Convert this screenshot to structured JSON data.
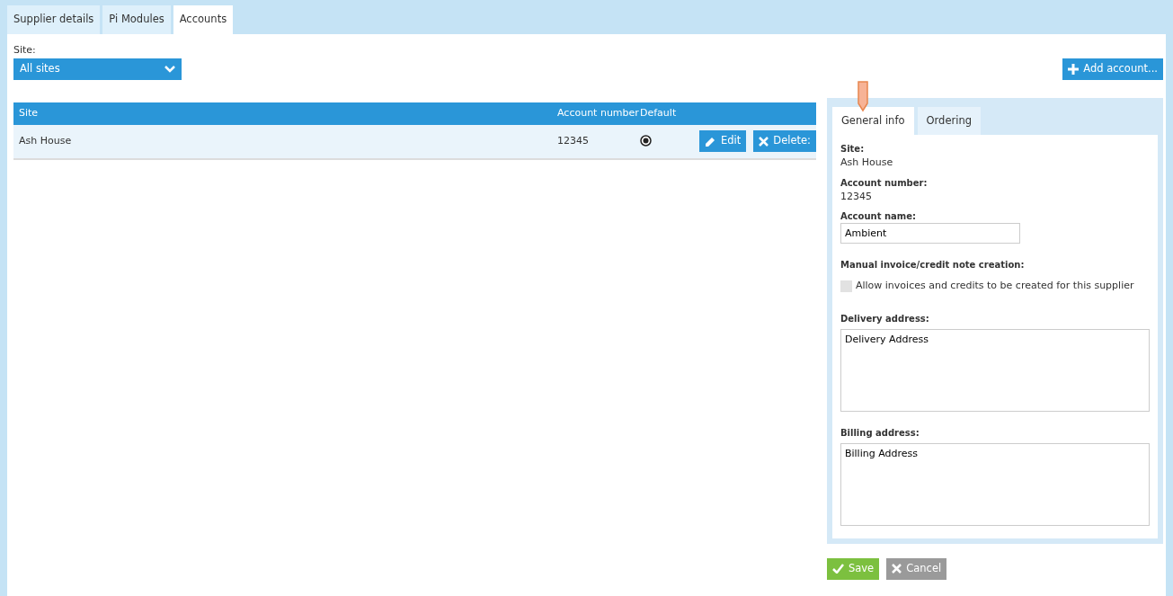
{
  "tabs": [
    {
      "label": "Supplier details",
      "selected": false
    },
    {
      "label": "Pi Modules",
      "selected": false
    },
    {
      "label": "Accounts",
      "selected": true
    }
  ],
  "site_filter": {
    "label": "Site:",
    "value": "All sites"
  },
  "add_button": {
    "label": "Add account..."
  },
  "table": {
    "columns": [
      "Site",
      "Account number",
      "Default"
    ],
    "rows": [
      {
        "site": "Ash House",
        "account_number": "12345",
        "default": true,
        "edit": "Edit",
        "delete": "Delete:"
      }
    ]
  },
  "detail": {
    "tabs": [
      {
        "label": "General info",
        "selected": true
      },
      {
        "label": "Ordering",
        "selected": false
      }
    ],
    "site_label": "Site:",
    "site_value": "Ash House",
    "account_number_label": "Account number:",
    "account_number_value": "12345",
    "account_name_label": "Account name:",
    "account_name_value": "Ambient",
    "manual_label": "Manual invoice/credit note creation:",
    "manual_checkbox": {
      "label": "Allow invoices and credits to be created for this supplier",
      "checked": false
    },
    "delivery_label": "Delivery address:",
    "delivery_value": "Delivery Address",
    "billing_label": "Billing address:",
    "billing_value": "Billing Address"
  },
  "save_button": "Save",
  "cancel_button": "Cancel"
}
